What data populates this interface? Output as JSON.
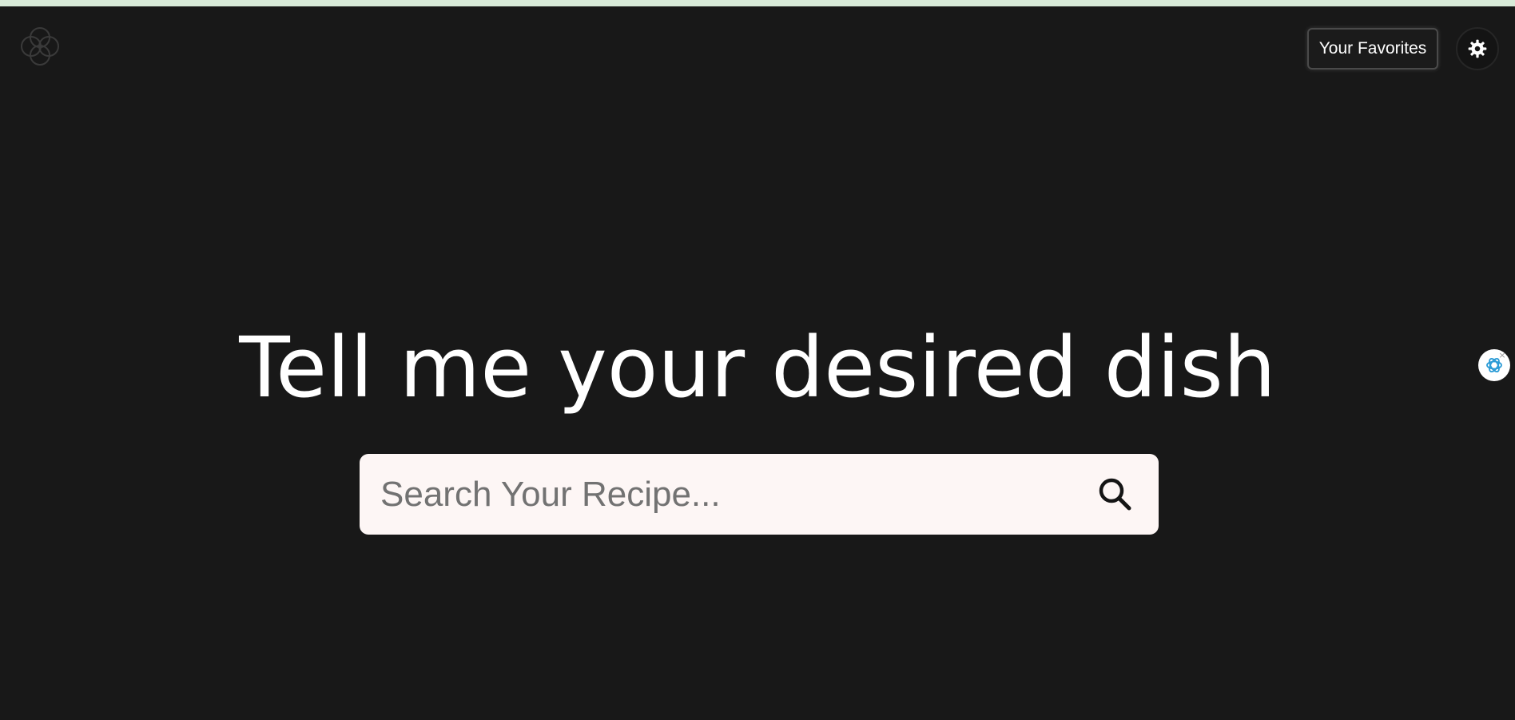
{
  "header": {
    "logo_icon": "interlocking-circles-logo-icon",
    "favorites_label": "Your Favorites",
    "theme_toggle_icon": "gear-icon"
  },
  "hero": {
    "title": "Tell me your desired dish"
  },
  "search": {
    "placeholder": "Search Your Recipe...",
    "value": "",
    "button_icon": "search-icon"
  },
  "assistant": {
    "icon": "openai-assistant-icon"
  },
  "colors": {
    "background": "#181818",
    "top_accent": "#d8ead8",
    "search_box": "#fdf6f5",
    "text_primary": "#ffffff",
    "placeholder": "#727272"
  }
}
